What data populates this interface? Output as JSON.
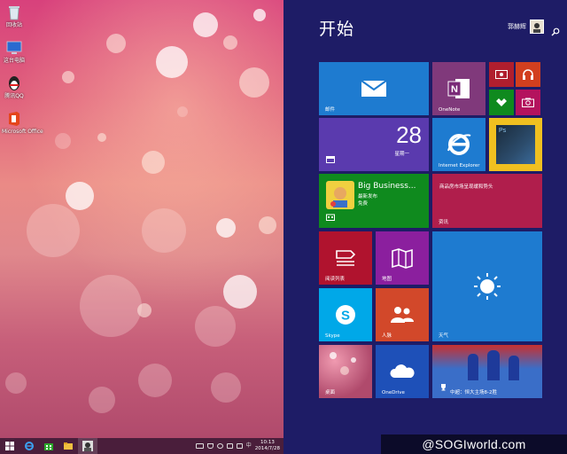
{
  "desktop": {
    "icons": [
      {
        "label": "回收站",
        "icon": "recycle-bin-icon"
      },
      {
        "label": "这台电脑",
        "icon": "computer-icon"
      },
      {
        "label": "腾讯QQ",
        "icon": "qq-penguin-icon"
      },
      {
        "label": "Microsoft Office",
        "icon": "office-icon"
      }
    ]
  },
  "taskbar": {
    "buttons": [
      "windows-logo-icon",
      "internet-explorer-icon",
      "store-icon",
      "file-explorer-icon",
      "user-photo-icon"
    ],
    "clock_time": "10:13",
    "clock_date": "2014/7/28"
  },
  "start": {
    "title": "开始",
    "user_name": "郭赫辉",
    "tiles": {
      "mail": {
        "label": "邮件",
        "icon": "mail-icon",
        "color": "#1e7bd0"
      },
      "onenote": {
        "label": "OneNote",
        "icon": "onenote-icon",
        "color": "#80397b"
      },
      "video": {
        "icon": "video-icon",
        "color": "#b01e2e"
      },
      "music": {
        "icon": "headphones-icon",
        "color": "#d23f1f"
      },
      "games": {
        "icon": "xbox-controller-icon",
        "color": "#0f8a1e"
      },
      "camera": {
        "icon": "camera-icon",
        "color": "#b4135e"
      },
      "calendar": {
        "day": "28",
        "weekday": "星期一",
        "icon": "calendar-icon",
        "color": "#5a3aae"
      },
      "ie": {
        "label": "Internet Explorer",
        "icon": "internet-explorer-icon",
        "color": "#1e7bd0"
      },
      "photoshop": {
        "icon": "photoshop-icon",
        "color": "#f0c020"
      },
      "store": {
        "app_name": "Big Business...",
        "rating_label": "最新发布",
        "price": "免费",
        "icon": "store-icon",
        "color": "#0f8a1e"
      },
      "news": {
        "headline": "商品房市场呈现缓和势头",
        "label": "资讯",
        "color": "#b01e4c"
      },
      "reading_list": {
        "label": "阅读列表",
        "icon": "reading-list-icon",
        "color": "#b0132e"
      },
      "maps": {
        "label": "地图",
        "icon": "map-icon",
        "color": "#8b1f9e"
      },
      "weather": {
        "label": "天气",
        "icon": "sun-icon",
        "color": "#1e7bd0"
      },
      "skype": {
        "label": "Skype",
        "icon": "skype-icon",
        "color": "#00a8e8"
      },
      "people": {
        "label": "人脉",
        "icon": "people-icon",
        "color": "#d2482a"
      },
      "desktop": {
        "label": "桌面",
        "color": "#b04a6c"
      },
      "onedrive": {
        "label": "OneDrive",
        "icon": "cloud-icon",
        "color": "#1e50b8"
      },
      "sports": {
        "label": "中超：恒大主场8-2胜",
        "icon": "trophy-icon",
        "color": "#3a6ec8"
      }
    }
  },
  "watermark": "@SOGIworld.com"
}
